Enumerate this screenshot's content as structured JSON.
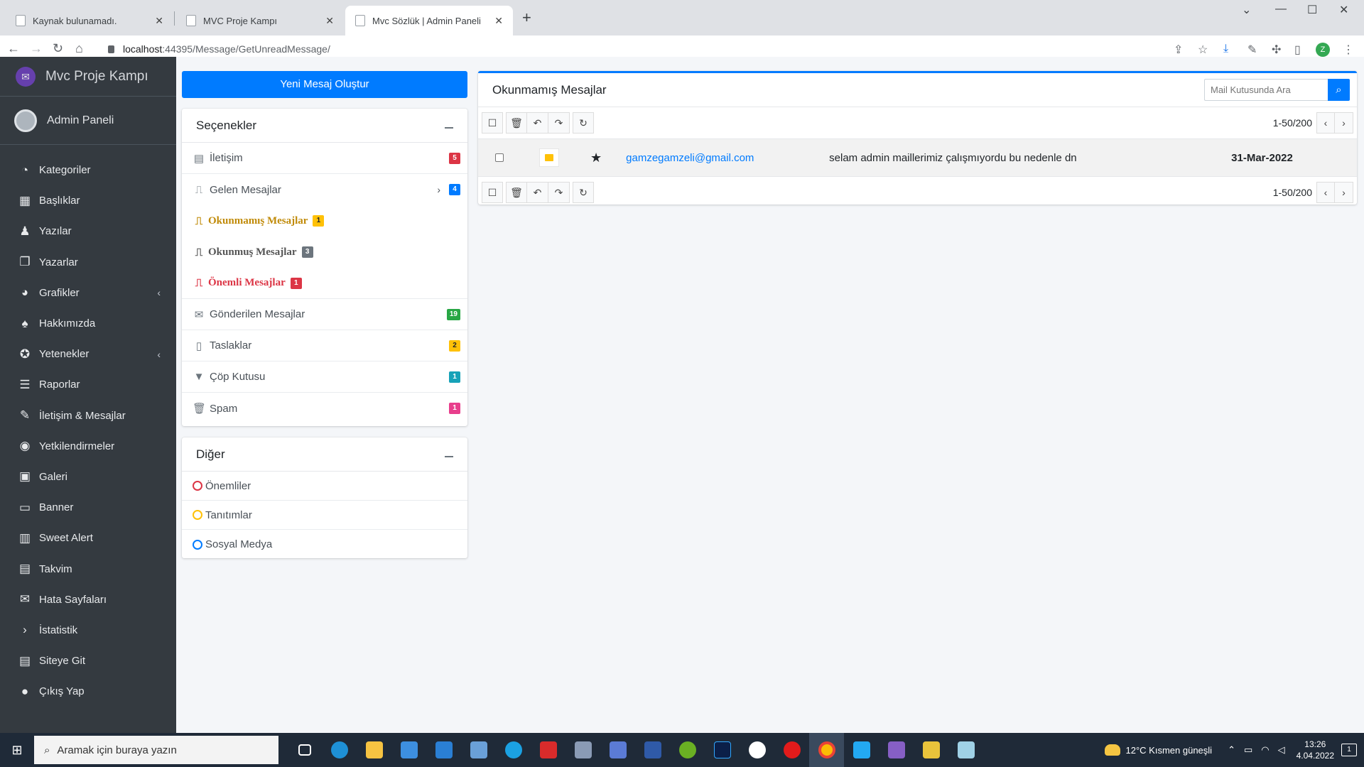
{
  "browser": {
    "tabs": [
      {
        "label": "Kaynak bulunamadı.",
        "close": "✕"
      },
      {
        "label": "MVC Proje Kampı",
        "close": "✕"
      },
      {
        "label": "Mvc Sözlük | Admin Paneli",
        "close": "✕"
      }
    ],
    "new_tab": "+",
    "url_host": "localhost",
    "url_rest": ":44395/Message/GetUnreadMessage/",
    "profile_initial": "Z"
  },
  "sidebar": {
    "brand": "Mvc Proje Kampı",
    "user": "Admin Paneli",
    "items": [
      {
        "label": "Kategoriler",
        "icon": "tachometer-icon",
        "glyph": "◔"
      },
      {
        "label": "Başlıklar",
        "icon": "grid-icon",
        "glyph": "▦"
      },
      {
        "label": "Yazılar",
        "icon": "user-tie-icon",
        "glyph": "♟"
      },
      {
        "label": "Yazarlar",
        "icon": "copy-icon",
        "glyph": "❐"
      },
      {
        "label": "Grafikler",
        "icon": "chart-pie-icon",
        "glyph": "◕",
        "arrow": "‹"
      },
      {
        "label": "Hakkımızda",
        "icon": "tree-icon",
        "glyph": "♠"
      },
      {
        "label": "Yetenekler",
        "icon": "award-icon",
        "glyph": "✪",
        "arrow": "‹"
      },
      {
        "label": "Raporlar",
        "icon": "bars-icon",
        "glyph": "☰"
      },
      {
        "label": "İletişim & Mesajlar",
        "icon": "edit-icon",
        "glyph": "✎"
      },
      {
        "label": "Yetkilendirmeler",
        "icon": "user-circle-icon",
        "glyph": "◉"
      },
      {
        "label": "Galeri",
        "icon": "image-icon",
        "glyph": "▣"
      },
      {
        "label": "Banner",
        "icon": "money-bill-icon",
        "glyph": "▭"
      },
      {
        "label": "Sweet Alert",
        "icon": "map-icon",
        "glyph": "▥"
      },
      {
        "label": "Takvim",
        "icon": "calendar-icon",
        "glyph": "▤"
      },
      {
        "label": "Hata Sayfaları",
        "icon": "envelope-icon",
        "glyph": "✉"
      },
      {
        "label": "İstatistik",
        "icon": "chevron-right-icon",
        "glyph": "›"
      },
      {
        "label": "Siteye Git",
        "icon": "list-icon",
        "glyph": "▤"
      },
      {
        "label": "Çıkış Yap",
        "icon": "apple-icon",
        "glyph": "●"
      }
    ]
  },
  "compose": {
    "label": "Yeni Mesaj Oluştur"
  },
  "options": {
    "title": "Seçenekler",
    "folders": [
      {
        "label": "İletişim",
        "icon": "address-card-icon",
        "glyph": "▤",
        "count": "5",
        "color": "#dc3545"
      },
      {
        "label": "Gelen Mesajlar",
        "icon": "inbox-icon",
        "glyph": "⎍",
        "count": "4",
        "color": "#007bff",
        "chev": "›"
      }
    ],
    "subfolders": [
      {
        "label": "Okunmamış Mesajlar",
        "icon": "inbox-icon",
        "glyph": "⎍",
        "count": "1",
        "color": "#c08a08",
        "badge": "#ffc107",
        "badge_text": "#212529"
      },
      {
        "label": "Okunmuş Mesajlar",
        "icon": "inbox-icon",
        "glyph": "⎍",
        "count": "3",
        "color": "#555555",
        "badge": "#6c757d",
        "badge_text": "#ffffff"
      },
      {
        "label": "Önemli Mesajlar",
        "icon": "inbox-icon",
        "glyph": "⎍",
        "count": "1",
        "color": "#dc3545",
        "badge": "#dc3545",
        "badge_text": "#ffffff"
      }
    ],
    "more_folders": [
      {
        "label": "Gönderilen Mesajlar",
        "icon": "envelope-icon",
        "glyph": "✉",
        "count": "19",
        "color": "#28a745"
      },
      {
        "label": "Taslaklar",
        "icon": "file-icon",
        "glyph": "▯",
        "count": "2",
        "color": "#ffc107"
      },
      {
        "label": "Çöp Kutusu",
        "icon": "filter-icon",
        "glyph": "▼",
        "count": "1",
        "color": "#17a2b8"
      },
      {
        "label": "Spam",
        "icon": "trash-icon",
        "glyph": "🗑",
        "count": "1",
        "color": "#e83e8c"
      }
    ]
  },
  "other": {
    "title": "Diğer",
    "labels": [
      {
        "label": "Önemliler",
        "color": "#dc3545"
      },
      {
        "label": "Tanıtımlar",
        "color": "#ffc107"
      },
      {
        "label": "Sosyal Medya",
        "color": "#007bff"
      }
    ]
  },
  "mailbox": {
    "title": "Okunmamış Mesajlar",
    "search_placeholder": "Mail Kutusunda Ara",
    "pager": "1-50/200",
    "messages": [
      {
        "sender": "gamzegamzeli@gmail.com",
        "subject": "selam admin maillerimiz çalışmıyordu bu nedenle dn",
        "date": "31-Mar-2022"
      }
    ]
  },
  "taskbar": {
    "search_placeholder": "Aramak için buraya yazın",
    "weather": "12°C  Kısmen güneşli",
    "time": "13:26",
    "date": "4.04.2022",
    "notifications": "1"
  }
}
